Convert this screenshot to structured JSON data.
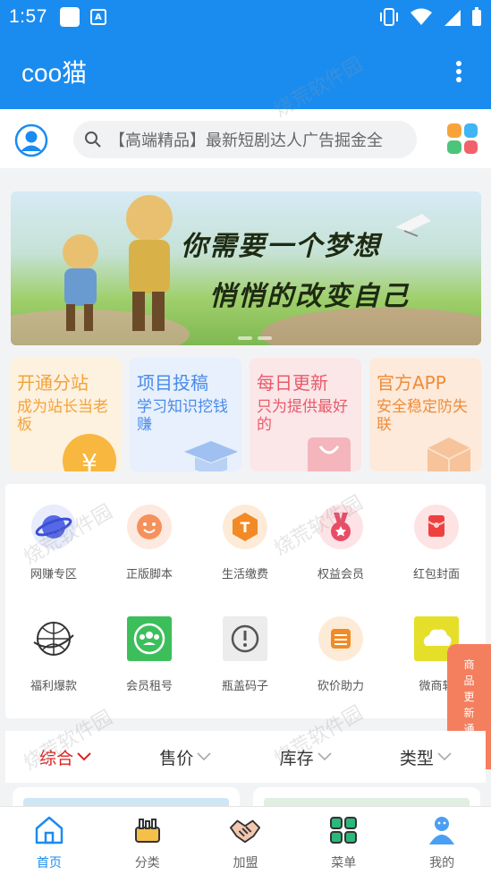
{
  "status": {
    "time": "1:57"
  },
  "app": {
    "title": "coo猫"
  },
  "search": {
    "text": "【高端精品】最新短剧达人广告掘金全"
  },
  "banner": {
    "line1": "你需要一个梦想",
    "line2": "悄悄的改变自己"
  },
  "promos": [
    {
      "title": "开通分站",
      "sub": "成为站长当老板",
      "color": "#f2a33a",
      "bg": "#fdf1df"
    },
    {
      "title": "项目投稿",
      "sub": "学习知识挖钱赚",
      "color": "#4a8be8",
      "bg": "#e7f0fc"
    },
    {
      "title": "每日更新",
      "sub": "只为提供最好的",
      "color": "#e85b6a",
      "bg": "#fbe6e8"
    },
    {
      "title": "官方APP",
      "sub": "安全稳定防失联",
      "color": "#ef8c3a",
      "bg": "#fdeadb"
    }
  ],
  "icons": [
    {
      "label": "网赚专区",
      "icon": "planet-icon"
    },
    {
      "label": "正版脚本",
      "icon": "smile-icon"
    },
    {
      "label": "生活缴费",
      "icon": "t-hexagon-icon"
    },
    {
      "label": "权益会员",
      "icon": "medal-icon"
    },
    {
      "label": "红包封面",
      "icon": "red-envelope-icon"
    },
    {
      "label": "福利爆款",
      "icon": "globe-sketch-icon"
    },
    {
      "label": "会员租号",
      "icon": "users-icon"
    },
    {
      "label": "瓶盖码子",
      "icon": "alert-icon"
    },
    {
      "label": "砍价助力",
      "icon": "bargain-icon"
    },
    {
      "label": "微商软",
      "icon": "cloud-icon"
    }
  ],
  "side_tab": {
    "text": "商品更新通知"
  },
  "sort": [
    {
      "label": "综合"
    },
    {
      "label": "售价"
    },
    {
      "label": "库存"
    },
    {
      "label": "类型"
    }
  ],
  "nav": [
    {
      "label": "首页",
      "icon": "home-icon"
    },
    {
      "label": "分类",
      "icon": "category-icon"
    },
    {
      "label": "加盟",
      "icon": "handshake-icon"
    },
    {
      "label": "菜单",
      "icon": "menu-grid-icon"
    },
    {
      "label": "我的",
      "icon": "user-icon"
    }
  ],
  "watermark": "烧荒软件园",
  "colors": {
    "primary": "#1a8cf0",
    "active_sort": "#dd2222",
    "side_tab": "#f47f5e"
  }
}
